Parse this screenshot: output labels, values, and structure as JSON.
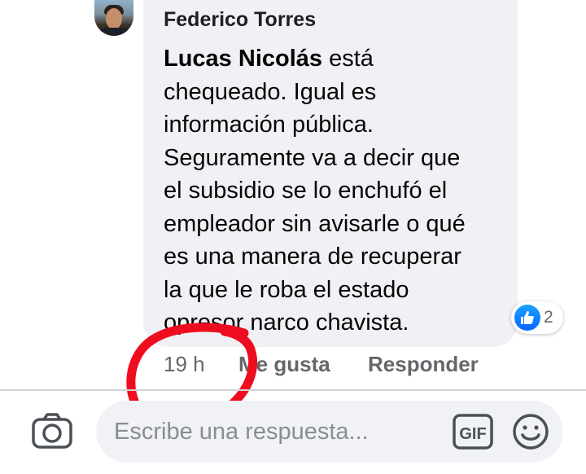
{
  "comment": {
    "author": "Federico Torres",
    "mention": "Lucas Nicolás",
    "text_lines": [
      "chequeado. Igual es",
      "información pública.",
      "Seguramente va a decir que",
      "el subsidio se lo enchufó el",
      "empleador sin avisarle o qué",
      "es una manera de recuperar",
      "la que le roba el estado",
      "opresor narco chavista."
    ],
    "first_line_suffix": " está",
    "reactions": {
      "icon": "like-icon",
      "count": "2",
      "color": "#0866ff"
    },
    "time": "19 h",
    "like_label": "Me gusta",
    "reply_label": "Responder"
  },
  "reply_bar": {
    "camera_icon": "camera-icon",
    "placeholder": "Escribe una respuesta...",
    "gif_label": "GIF",
    "emoji_icon": "smiley-icon"
  },
  "annotation": {
    "type": "hand-drawn-circle",
    "color": "#ee0d1e",
    "target": "time"
  }
}
